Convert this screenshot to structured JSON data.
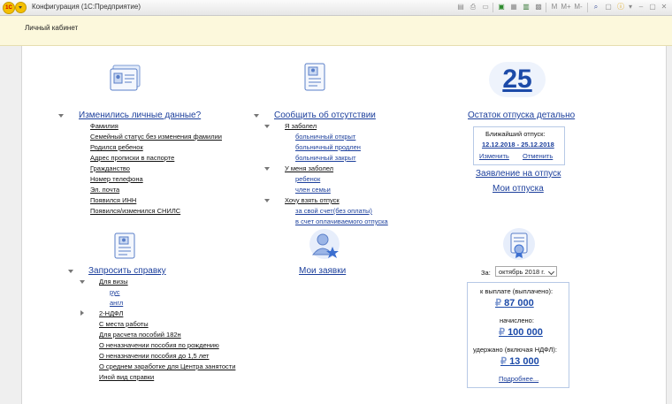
{
  "window": {
    "title": "Конфигурация  (1С:Предприятие)",
    "toolbar_icons": [
      "save-icon",
      "print-icon",
      "preview-icon",
      "attach-icon",
      "calendar-icon",
      "calculator-icon",
      "memory-m-icon",
      "memory-mplus-icon",
      "memory-mminus-icon",
      "search-icon",
      "zoom-icon",
      "info-icon",
      "minimize-icon",
      "maximize-icon",
      "close-icon"
    ],
    "memory_labels": {
      "m": "M",
      "mplus": "M+",
      "mminus": "M-"
    }
  },
  "header": {
    "title": "Личный кабинет"
  },
  "personal_data": {
    "heading": "Изменились личные данные?",
    "items": [
      "Фамилия",
      "Семейный статус без изменения фамилии",
      "Родился ребенок",
      "Адрес прописки в паспорте",
      "Гражданство",
      "Номер телефона",
      "Эл. почта",
      "Появился ИНН",
      "Появился/изменился СНИЛС"
    ]
  },
  "absence": {
    "heading": "Сообщить об отсутствии",
    "groups": [
      {
        "label": "Я заболел",
        "items": [
          "больничный открыт",
          "больничный продлен",
          "больничный закрыт"
        ]
      },
      {
        "label": "У меня заболел",
        "items": [
          "ребенок",
          "член семьи"
        ]
      },
      {
        "label": "Хочу взять отпуск",
        "items": [
          "за свой счет(без оплаты)",
          "в счет оплачиваемого отпуска"
        ]
      }
    ]
  },
  "vacation": {
    "days": "25",
    "balance_link": "Остаток отпуска детально",
    "nearest_label": "Ближайший отпуск:",
    "nearest_dates": "12.12.2018 - 25.12.2018",
    "change": "Изменить",
    "cancel": "Отменить",
    "application": "Заявление на отпуск",
    "my_vacations": "Мои отпуска"
  },
  "certificate": {
    "heading": "Запросить справку",
    "visa": {
      "label": "Для визы",
      "items": [
        "рус",
        "англ"
      ]
    },
    "items": [
      "2-НДФЛ",
      "С места работы",
      "Для расчета пособий 182н",
      "О неназначении пособия по рождению",
      "О неназначении пособия до 1,5 лет",
      "О среднем заработке для Центра занятости",
      "Иной вид справки"
    ]
  },
  "requests": {
    "heading": "Мои заявки"
  },
  "payroll": {
    "period_label": "За:",
    "period_value": "октябрь 2018 г.",
    "paid_label": "к выплате (выплачено):",
    "paid_value": "87 000",
    "accrued_label": "начислено:",
    "accrued_value": "100 000",
    "withheld_label": "удержано (включая НДФЛ):",
    "withheld_value": "13 000",
    "currency_symbol": "₽",
    "more": "Подробнее..."
  }
}
